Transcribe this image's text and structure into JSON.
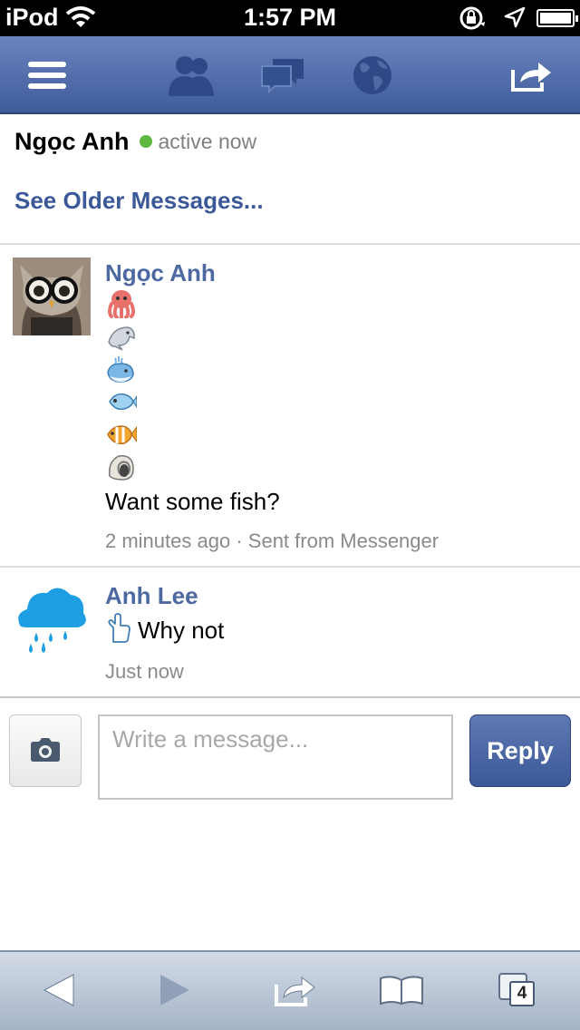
{
  "status_bar": {
    "carrier": "iPod",
    "time": "1:57 PM"
  },
  "navbar": {
    "icons": [
      "menu-icon",
      "friends-icon",
      "messages-icon",
      "globe-icon",
      "share-icon"
    ]
  },
  "conversation": {
    "contact_name": "Ngọc Anh",
    "status": "active now",
    "older_link": "See Older Messages..."
  },
  "messages": [
    {
      "sender": "Ngọc Anh",
      "emojis": [
        "octopus",
        "dolphin",
        "whale",
        "fish",
        "tropical-fish",
        "shell"
      ],
      "text": "Want some fish?",
      "time": "2 minutes ago",
      "separator": "·",
      "source": "Sent from Messenger"
    },
    {
      "sender": "Anh Lee",
      "emoji": "thumbs-up-hand",
      "text": "Why not",
      "time": "Just now"
    }
  ],
  "composer": {
    "placeholder": "Write a message...",
    "value": "",
    "reply_label": "Reply"
  },
  "toolbar": {
    "tab_count": "4"
  },
  "colors": {
    "fb_blue": "#3b5998",
    "sender_blue": "#4e69a2",
    "active_green": "#5fb940"
  }
}
